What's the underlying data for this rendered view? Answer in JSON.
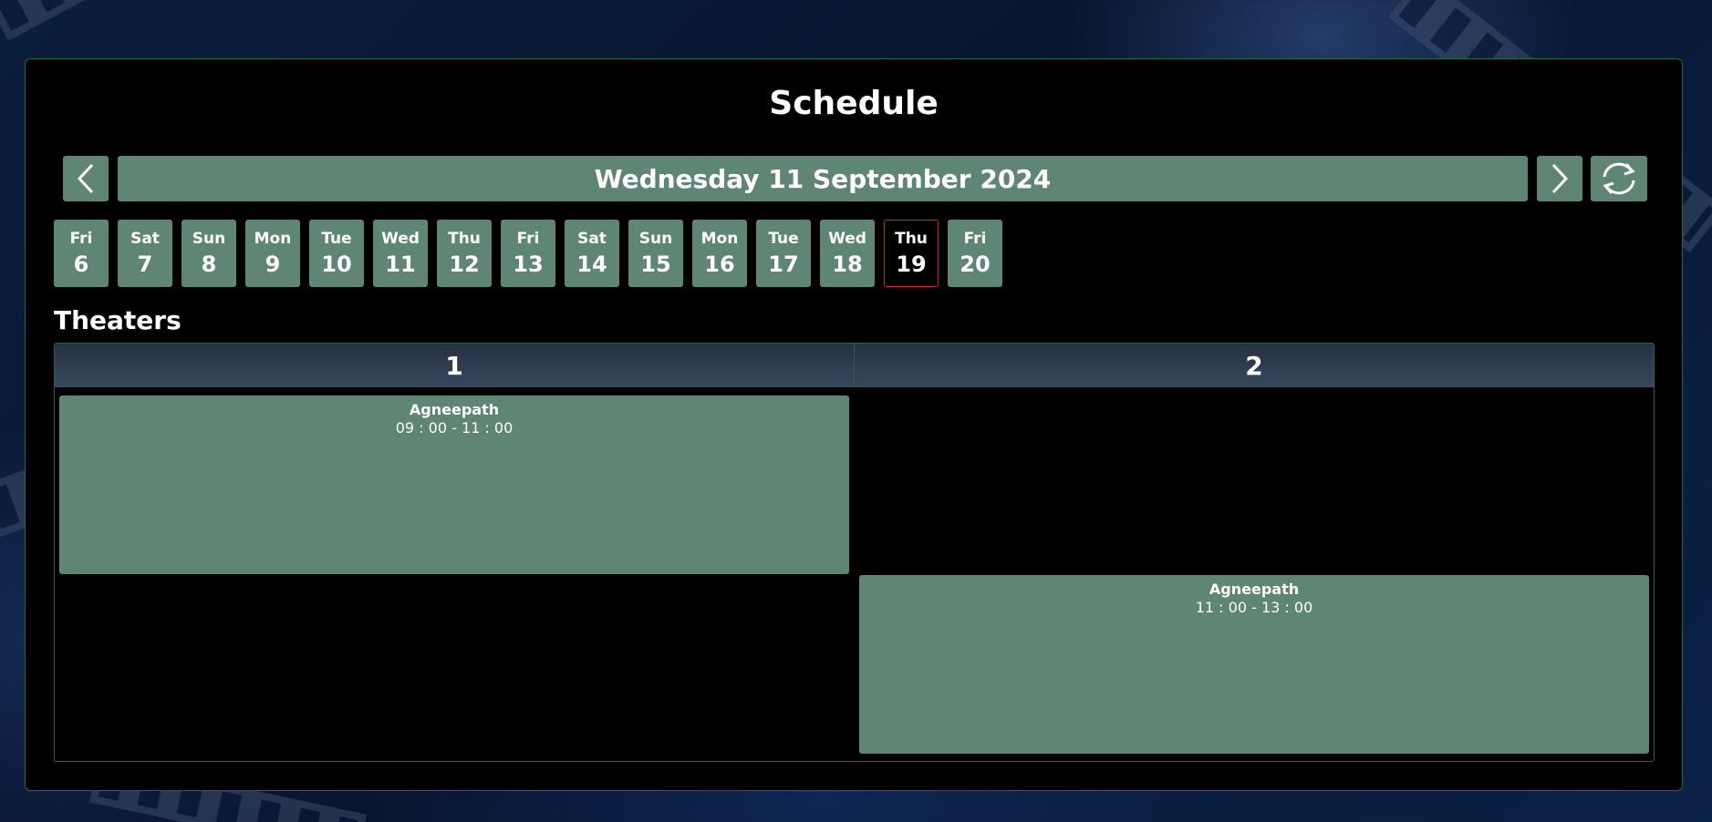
{
  "header": {
    "title": "Schedule"
  },
  "date_nav": {
    "current_date": "Wednesday 11 September 2024",
    "prev_icon": "chevron-left-icon",
    "next_icon": "chevron-right-icon",
    "refresh_icon": "refresh-icon"
  },
  "days": [
    {
      "dow": "Fri",
      "num": "6"
    },
    {
      "dow": "Sat",
      "num": "7"
    },
    {
      "dow": "Sun",
      "num": "8"
    },
    {
      "dow": "Mon",
      "num": "9"
    },
    {
      "dow": "Tue",
      "num": "10"
    },
    {
      "dow": "Wed",
      "num": "11"
    },
    {
      "dow": "Thu",
      "num": "12"
    },
    {
      "dow": "Fri",
      "num": "13"
    },
    {
      "dow": "Sat",
      "num": "14"
    },
    {
      "dow": "Sun",
      "num": "15"
    },
    {
      "dow": "Mon",
      "num": "16"
    },
    {
      "dow": "Tue",
      "num": "17"
    },
    {
      "dow": "Wed",
      "num": "18"
    },
    {
      "dow": "Thu",
      "num": "19",
      "current": true
    },
    {
      "dow": "Fri",
      "num": "20"
    }
  ],
  "theaters": {
    "label": "Theaters",
    "columns": [
      "1",
      "2"
    ],
    "shows": [
      {
        "theater": "1",
        "movie": "Agneepath",
        "time": "09 : 00 - 11 : 00"
      },
      {
        "theater": "2",
        "movie": "Agneepath",
        "time": "11 : 00 - 13 : 00"
      }
    ]
  },
  "colors": {
    "accent": "#5f8574",
    "border": "#1f6b3a",
    "current_day_border": "#c0282a",
    "panel_bg": "#000000"
  }
}
